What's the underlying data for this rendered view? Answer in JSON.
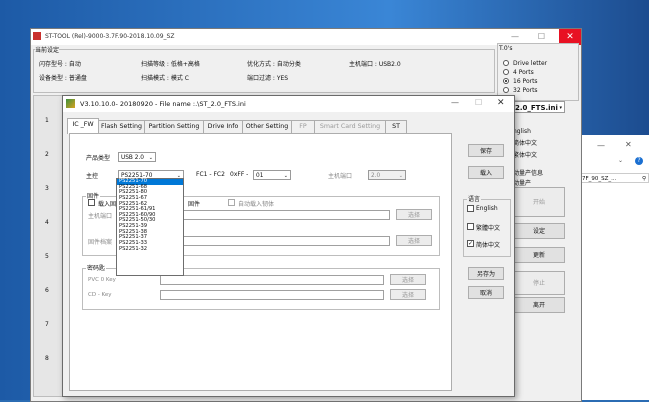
{
  "back_window": {
    "title": "ST-TOOL (Rel)-9000-3.7F.90-2018.10.09_SZ",
    "group_current": "当前设定",
    "rows": [
      [
        "闪存型号 : 自动",
        "扫描等级 : 低格+高格",
        "优化方式 : 自动分类",
        "主机端口 : USB2.0"
      ],
      [
        "设备类型 : 普通盘",
        "扫描模式 : 模式 C",
        "端口过滤 : YES",
        ""
      ]
    ],
    "ini_label": "T.0's",
    "radios": [
      "Drive letter",
      "4 Ports",
      "16 Ports",
      "32 Ports"
    ],
    "radio_selected": "16 Ports",
    "ini_combo": "2.0_FTS.ini",
    "lang_items": [
      "nglish",
      "简体中文",
      "繁体中文"
    ],
    "drive_info": "动量产信息",
    "mass": "动量产",
    "side_buttons": [
      "开始",
      "设定",
      "更新",
      "停止",
      "离开"
    ],
    "port_numbers": [
      "1",
      "2",
      "3",
      "4",
      "5",
      "6",
      "7",
      "8"
    ]
  },
  "explorer": {
    "path_text": "7F_90_SZ_...",
    "search_icon": "search-icon",
    "help_icon": "help-icon"
  },
  "dialog": {
    "title": "V3.10.10.0- 20180920 - File name :.\\ST_2.0_FTS.ini",
    "tabs": [
      {
        "label": "IC _FW",
        "active": true,
        "enabled": true
      },
      {
        "label": "Flash Setting",
        "active": false,
        "enabled": true
      },
      {
        "label": "Partition Setting",
        "active": false,
        "enabled": true
      },
      {
        "label": "Drive Info",
        "active": false,
        "enabled": true
      },
      {
        "label": "Other Setting",
        "active": false,
        "enabled": true
      },
      {
        "label": "FP",
        "active": false,
        "enabled": false
      },
      {
        "label": "Smart Card Setting",
        "active": false,
        "enabled": false
      },
      {
        "label": "ST",
        "active": false,
        "enabled": true
      }
    ],
    "product_type_label": "产品类型",
    "product_type_value": "USB 2.0",
    "controller_label": "主控",
    "controller_value": "PS2251-70",
    "fc_label": "FC1 - FC2",
    "oxff_label": "0xFF -",
    "fc_value": "01",
    "host_port_label": "主机端口",
    "host_port_value": "2.0",
    "controller_options": [
      "PS2251-70",
      "PS2251-68",
      "PS2251-80",
      "PS2251-67",
      "PS2251-62",
      "PS2251-61/91",
      "PS2251-60/90",
      "PS2251-50/30",
      "PS2251-39",
      "PS2251-38",
      "PS2251-37",
      "PS2251-33",
      "PS2251-32"
    ],
    "firmware_group": "固件",
    "load_fw_label": "载入固",
    "fw_mid_label": "固件",
    "auto_load_label": "自动载入韧体",
    "host_fw_label": "主机端口",
    "fw_archive_label": "固件档案",
    "password_group": "密码匙",
    "pvc_label": "PVC 0 Key",
    "cd_label": "CD - Key",
    "browse": "选择",
    "save": "保存",
    "load": "载入",
    "language_label": "语言",
    "langs": [
      {
        "label": "English",
        "checked": false
      },
      {
        "label": "繁體中文",
        "checked": false
      },
      {
        "label": "简体中文",
        "checked": true
      }
    ],
    "save_as": "另存为",
    "cancel": "取消"
  }
}
